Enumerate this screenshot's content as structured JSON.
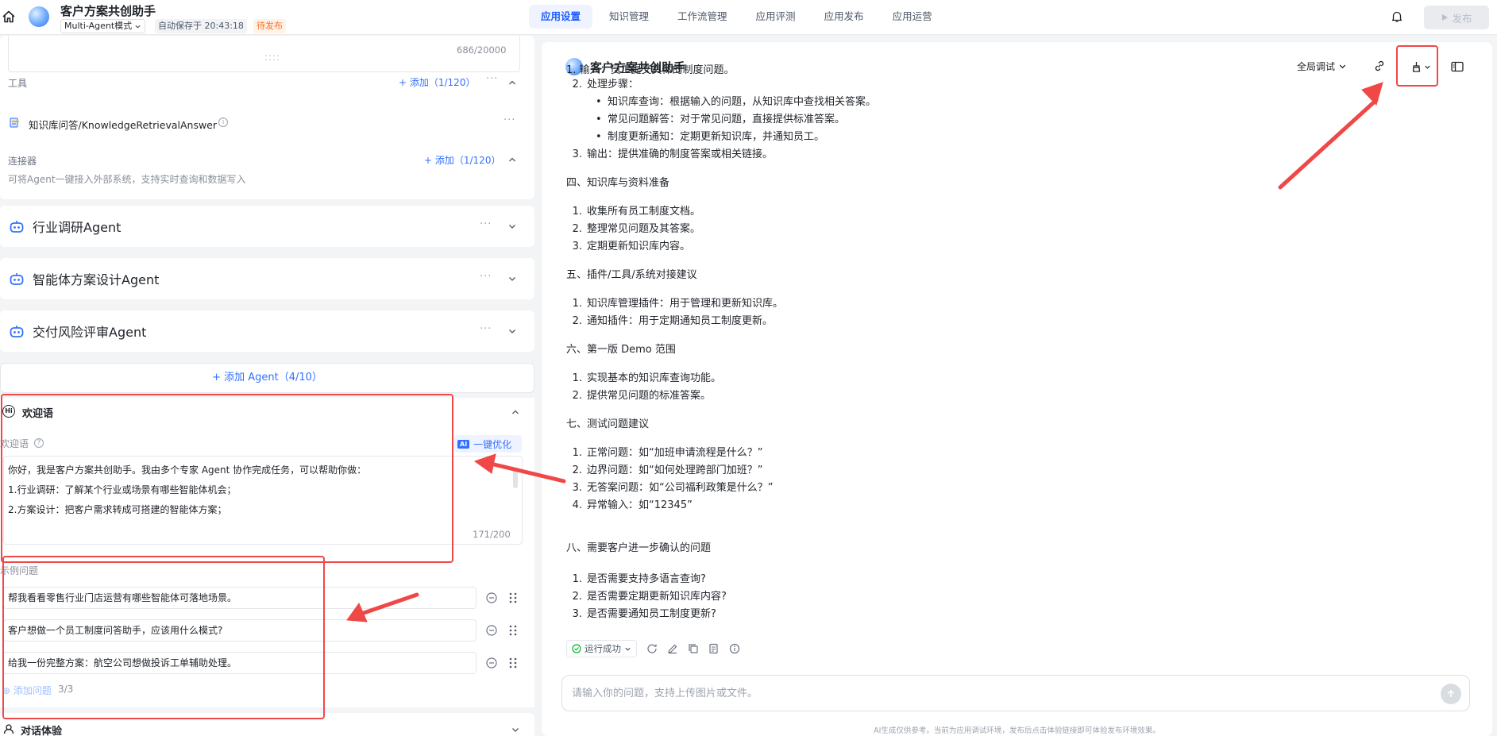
{
  "header": {
    "app_title": "客户方案共创助手",
    "mode": "Multi-Agent模式",
    "autosave": "自动保存于 20:43:18",
    "status_badge": "待发布",
    "tabs": [
      "应用设置",
      "知识管理",
      "工作流管理",
      "应用评测",
      "应用发布",
      "应用运营"
    ],
    "active_tab": "应用设置",
    "publish_label": "发布"
  },
  "left": {
    "prompt_counter": "686/20000",
    "tools": {
      "label": "工具",
      "add_label": "+ 添加（1/120）",
      "items": [
        {
          "name": "知识库问答/KnowledgeRetrievalAnswer"
        }
      ]
    },
    "connectors": {
      "label": "连接器",
      "add_label": "+ 添加（1/120）",
      "hint": "可将Agent一键接入外部系统，支持实时查询和数据写入"
    },
    "agents": [
      {
        "name": "行业调研Agent"
      },
      {
        "name": "智能体方案设计Agent"
      },
      {
        "name": "交付风险评审Agent"
      }
    ],
    "add_agent_label": "+ 添加 Agent（4/10）",
    "welcome": {
      "section_title": "欢迎语",
      "field_label": "欢迎语",
      "optimize_label": "一键优化",
      "lines": [
        "你好，我是客户方案共创助手。我由多个专家 Agent 协作完成任务，可以帮助你做：",
        "1.行业调研：了解某个行业或场景有哪些智能体机会；",
        "2.方案设计：把客户需求转成可搭建的智能体方案；"
      ],
      "counter": "171/200"
    },
    "examples": {
      "label": "示例问题",
      "questions": [
        "帮我看看零售行业门店运营有哪些智能体可落地场景。",
        "客户想做一个员工制度问答助手，应该用什么模式?",
        "给我一份完整方案：航空公司想做投诉工单辅助处理。"
      ],
      "add_label": "添加问题",
      "count": "3/3"
    },
    "chat_experience_label": "对话体验"
  },
  "right": {
    "title": "客户方案共创助手",
    "debug_scope": "全局调试",
    "message": {
      "top_cut": "1. 输入：员工提交具体的制度问题。",
      "step2_title": "处理步骤：",
      "step2_bullets": [
        "知识库查询：根据输入的问题，从知识库中查找相关答案。",
        "常见问题解答：对于常见问题，直接提供标准答案。",
        "制度更新通知：定期更新知识库，并通知员工。"
      ],
      "step3": "输出：提供准确的制度答案或相关链接。",
      "sections": [
        {
          "title": "四、知识库与资料准备",
          "items": [
            "收集所有员工制度文档。",
            "整理常见问题及其答案。",
            "定期更新知识库内容。"
          ]
        },
        {
          "title": "五、插件/工具/系统对接建议",
          "items": [
            "知识库管理插件：用于管理和更新知识库。",
            "通知插件：用于定期通知员工制度更新。"
          ]
        },
        {
          "title": "六、第一版 Demo 范围",
          "items": [
            "实现基本的知识库查询功能。",
            "提供常见问题的标准答案。"
          ]
        },
        {
          "title": "七、测试问题建议",
          "items": [
            "正常问题：如“加班申请流程是什么？”",
            "边界问题：如“如何处理跨部门加班？”",
            "无答案问题：如“公司福利政策是什么？”",
            "异常输入：如“12345”"
          ]
        },
        {
          "title": "八、需要客户进一步确认的问题",
          "items": [
            "是否需要支持多语言查询?",
            "是否需要定期更新知识库内容?",
            "是否需要通知员工制度更新?"
          ]
        }
      ]
    },
    "run_status": "运行成功",
    "input_placeholder": "请输入你的问题，支持上传图片或文件。",
    "disclaimer": "AI生成仅供参考。当前为应用调试环境，发布后点击体验链接即可体验发布环境效果。"
  },
  "colors": {
    "accent": "#3370ff",
    "annotation": "#f04747",
    "warning": "#f77234"
  }
}
